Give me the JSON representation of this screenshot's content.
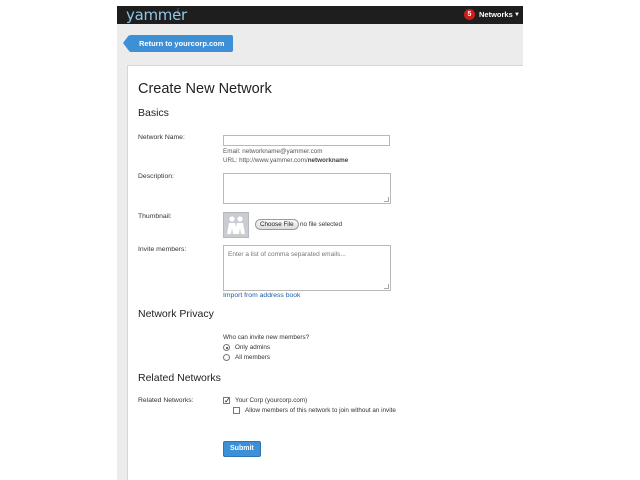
{
  "header": {
    "logo_text": "yammer",
    "notification_count": "5",
    "networks_label": "Networks"
  },
  "back_button": {
    "label": "Return to yourcorp.com"
  },
  "page": {
    "title": "Create New Network"
  },
  "basics": {
    "heading": "Basics",
    "network_name": {
      "label": "Network Name:",
      "value": "",
      "email_hint_prefix": "Email: ",
      "email_hint_value": "networkname@yammer.com",
      "url_hint_prefix": "URL: http://www.yammer.com/",
      "url_hint_bold": "networkname"
    },
    "description": {
      "label": "Description:",
      "value": ""
    },
    "thumbnail": {
      "label": "Thumbnail:",
      "choose_button": "Choose File",
      "no_file_text": "no file selected"
    },
    "invite": {
      "label": "Invite members:",
      "placeholder": "Enter a list of comma separated emails...",
      "import_link": "Import from address book"
    }
  },
  "privacy": {
    "heading": "Network Privacy",
    "question": "Who can invite new members?",
    "options": [
      {
        "label": "Only admins",
        "selected": true
      },
      {
        "label": "All members",
        "selected": false
      }
    ]
  },
  "related": {
    "heading": "Related Networks",
    "label": "Related Networks:",
    "network_checkbox": {
      "label": "Your Corp (yourcorp.com)",
      "checked": true
    },
    "allow_checkbox": {
      "label": "Allow members of this network to join without an invite",
      "checked": false
    }
  },
  "submit": {
    "label": "Submit"
  },
  "colors": {
    "accent": "#3d8fd6",
    "topbar": "#1e1e1e",
    "logo": "#8ec7e8",
    "badge": "#c81e1e",
    "link": "#1b5ea3"
  }
}
